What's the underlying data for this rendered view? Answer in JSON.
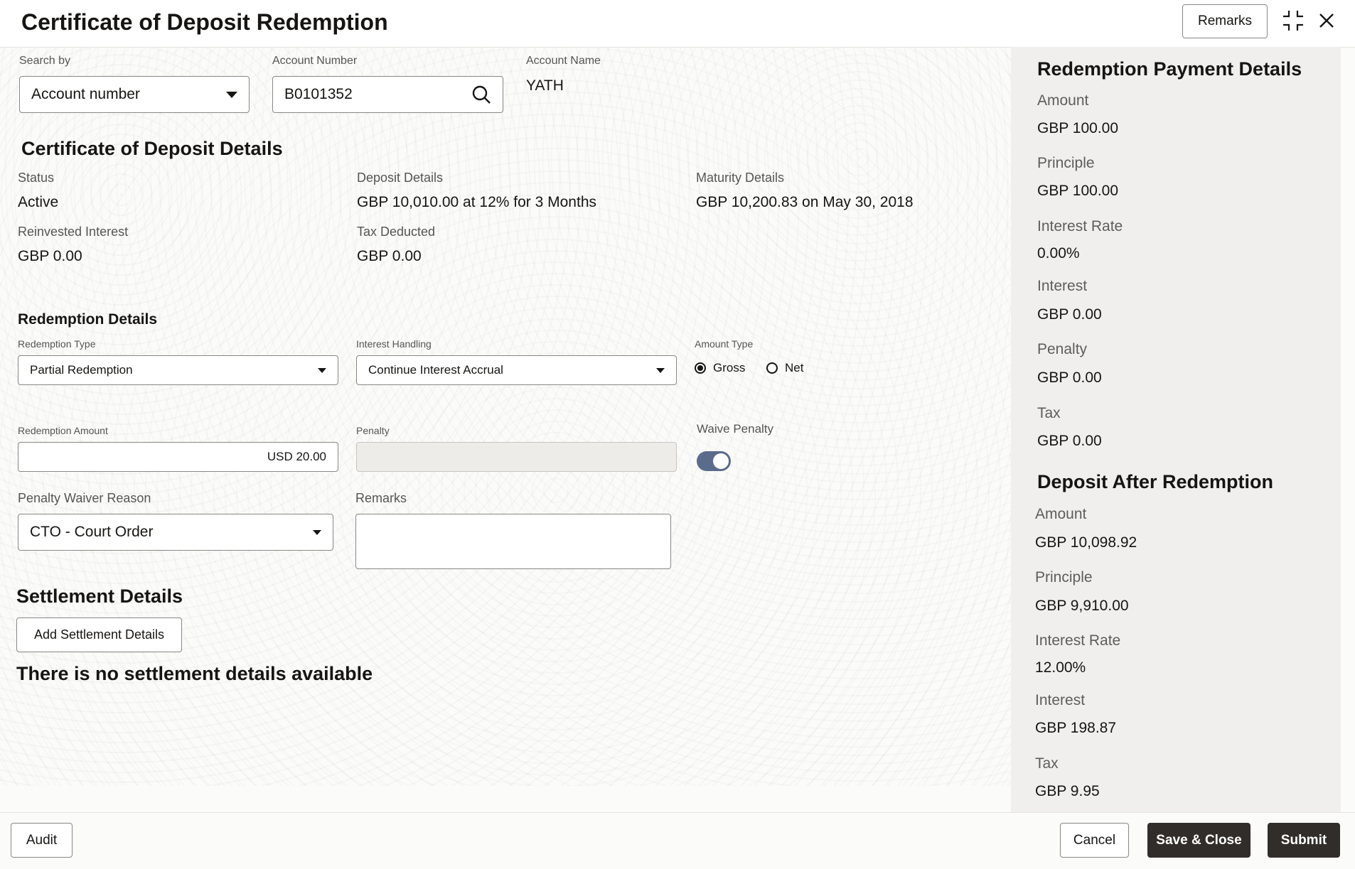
{
  "header": {
    "title": "Certificate of Deposit Redemption",
    "remarks_label": "Remarks"
  },
  "search": {
    "search_by_label": "Search by",
    "search_by_value": "Account number",
    "account_number_label": "Account Number",
    "account_number_value": "B0101352",
    "account_name_label": "Account Name",
    "account_name_value": "YATH"
  },
  "cd_details": {
    "title": "Certificate of Deposit Details",
    "status_label": "Status",
    "status_value": "Active",
    "deposit_label": "Deposit Details",
    "deposit_value": "GBP 10,010.00 at 12% for 3 Months",
    "maturity_label": "Maturity Details",
    "maturity_value": "GBP 10,200.83 on May 30, 2018",
    "reinvested_label": "Reinvested Interest",
    "reinvested_value": "GBP 0.00",
    "tax_label": "Tax Deducted",
    "tax_value": "GBP 0.00"
  },
  "redemption": {
    "title": "Redemption Details",
    "type_label": "Redemption Type",
    "type_value": "Partial Redemption",
    "interest_label": "Interest Handling",
    "interest_value": "Continue Interest Accrual",
    "amount_type_label": "Amount Type",
    "amount_type_options": [
      "Gross",
      "Net"
    ],
    "amount_type_selected": "Gross",
    "amount_label": "Redemption Amount",
    "amount_value": "USD 20.00",
    "penalty_label": "Penalty",
    "penalty_value": "",
    "waive_label": "Waive Penalty",
    "waive_on": true,
    "waiver_reason_label": "Penalty Waiver Reason",
    "waiver_reason_value": "CTO - Court Order",
    "remarks_label": "Remarks",
    "remarks_value": ""
  },
  "settlement": {
    "title": "Settlement Details",
    "add_button": "Add Settlement Details",
    "empty_message": "There is no settlement details available"
  },
  "payment_details": {
    "title": "Redemption Payment Details",
    "items": [
      {
        "label": "Amount",
        "value": "GBP 100.00"
      },
      {
        "label": "Principle",
        "value": "GBP 100.00"
      },
      {
        "label": "Interest Rate",
        "value": "0.00%"
      },
      {
        "label": "Interest",
        "value": "GBP 0.00"
      },
      {
        "label": "Penalty",
        "value": "GBP 0.00"
      },
      {
        "label": "Tax",
        "value": "GBP 0.00"
      }
    ]
  },
  "after_redemption": {
    "title": "Deposit After Redemption",
    "items": [
      {
        "label": "Amount",
        "value": "GBP 10,098.92"
      },
      {
        "label": "Principle",
        "value": "GBP 9,910.00"
      },
      {
        "label": "Interest Rate",
        "value": "12.00%"
      },
      {
        "label": "Interest",
        "value": "GBP 198.87"
      },
      {
        "label": "Tax",
        "value": "GBP 9.95"
      }
    ]
  },
  "footer": {
    "audit": "Audit",
    "cancel": "Cancel",
    "save_close": "Save & Close",
    "submit": "Submit"
  },
  "colors": {
    "primary_button": "#312d2a",
    "side_panel": "#f1efed",
    "toggle_on": "#5b6b8c"
  }
}
